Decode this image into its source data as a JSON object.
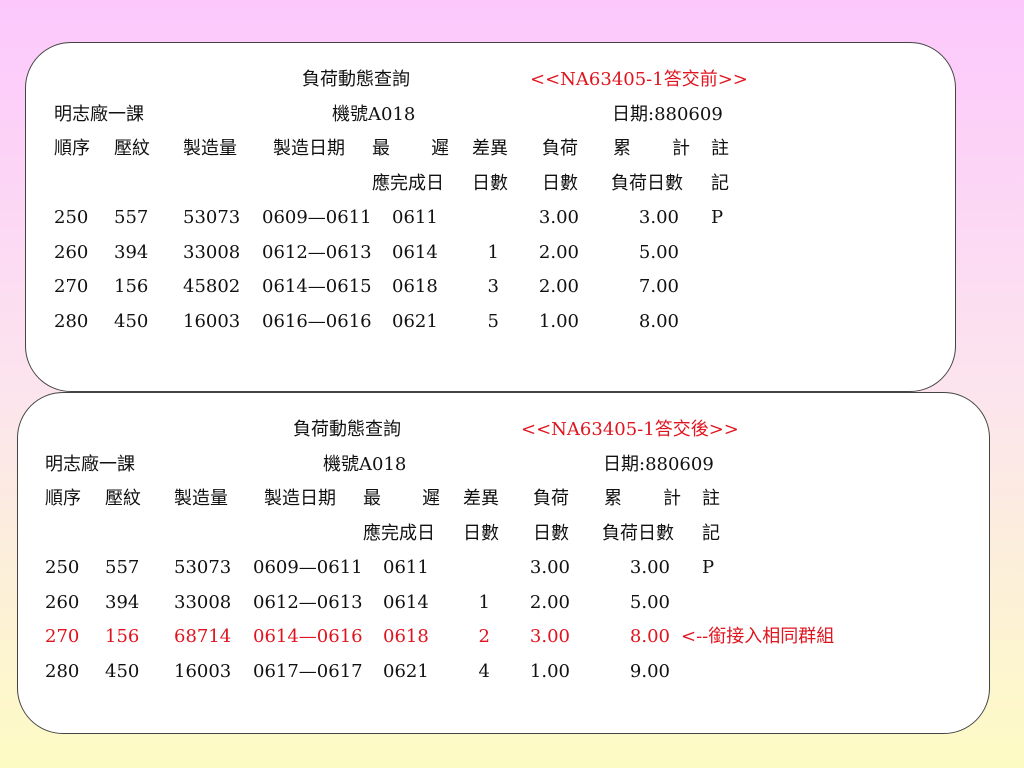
{
  "reports": [
    {
      "title": "負荷動態查詢",
      "tag": "<<NA63405-1答交前>>",
      "dept": "明志廠一課",
      "machine": "機號A018",
      "date": "日期:880609",
      "headers": {
        "seq": "順序",
        "pattern": "壓紋",
        "qty": "製造量",
        "mfg_date": "製造日期",
        "latest_a": "最",
        "latest_b": "遲",
        "latest_line2": "應完成日",
        "diff": "差異",
        "diff_line2": "日數",
        "load": "負荷",
        "load_line2": "日數",
        "cum_a": "累",
        "cum_b": "計",
        "cum_line2": "負荷日數",
        "note": "註",
        "note_line2": "記"
      },
      "rows": [
        {
          "seq": "250",
          "pattern": "557",
          "qty": "53073",
          "mfg": "0609—0611",
          "due": "0611",
          "diff": "",
          "load": "3.00",
          "cum": "3.00",
          "note": "P"
        },
        {
          "seq": "260",
          "pattern": "394",
          "qty": "33008",
          "mfg": "0612—0613",
          "due": "0614",
          "diff": "1",
          "load": "2.00",
          "cum": "5.00",
          "note": ""
        },
        {
          "seq": "270",
          "pattern": "156",
          "qty": "45802",
          "mfg": "0614—0615",
          "due": "0618",
          "diff": "3",
          "load": "2.00",
          "cum": "7.00",
          "note": ""
        },
        {
          "seq": "280",
          "pattern": "450",
          "qty": "16003",
          "mfg": "0616—0616",
          "due": "0621",
          "diff": "5",
          "load": "1.00",
          "cum": "8.00",
          "note": ""
        }
      ]
    },
    {
      "title": "負荷動態查詢",
      "tag": "<<NA63405-1答交後>>",
      "dept": "明志廠一課",
      "machine": "機號A018",
      "date": "日期:880609",
      "headers": {
        "seq": "順序",
        "pattern": "壓紋",
        "qty": "製造量",
        "mfg_date": "製造日期",
        "latest_a": "最",
        "latest_b": "遲",
        "latest_line2": "應完成日",
        "diff": "差異",
        "diff_line2": "日數",
        "load": "負荷",
        "load_line2": "日數",
        "cum_a": "累",
        "cum_b": "計",
        "cum_line2": "負荷日數",
        "note": "註",
        "note_line2": "記"
      },
      "rows": [
        {
          "seq": "250",
          "pattern": "557",
          "qty": "53073",
          "mfg": "0609—0611",
          "due": "0611",
          "diff": "",
          "load": "3.00",
          "cum": "3.00",
          "note": "P"
        },
        {
          "seq": "260",
          "pattern": "394",
          "qty": "33008",
          "mfg": "0612—0613",
          "due": "0614",
          "diff": "1",
          "load": "2.00",
          "cum": "5.00",
          "note": ""
        },
        {
          "seq": "270",
          "pattern": "156",
          "qty": "68714",
          "mfg": "0614—0616",
          "due": "0618",
          "diff": "2",
          "load": "3.00",
          "cum": "8.00",
          "note": "<--銜接入相同群組",
          "highlight": true
        },
        {
          "seq": "280",
          "pattern": "450",
          "qty": "16003",
          "mfg": "0617—0617",
          "due": "0621",
          "diff": "4",
          "load": "1.00",
          "cum": "9.00",
          "note": ""
        }
      ]
    }
  ]
}
